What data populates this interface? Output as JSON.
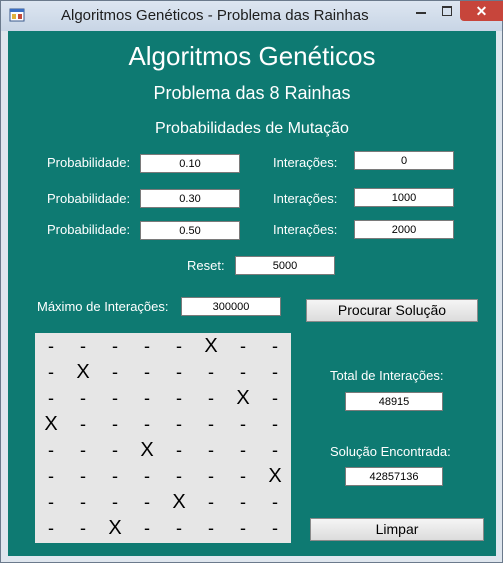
{
  "window": {
    "title": "Algoritmos Genéticos - Problema das Rainhas",
    "close_glyph": "✕"
  },
  "header": {
    "title": "Algoritmos Genéticos",
    "subtitle": "Problema das 8 Rainhas",
    "section": "Probabilidades de Mutação"
  },
  "mutation_rows": [
    {
      "prob_label": "Probabilidade:",
      "prob_value": "0.10",
      "iter_label": "Interações:",
      "iter_value": "0"
    },
    {
      "prob_label": "Probabilidade:",
      "prob_value": "0.30",
      "iter_label": "Interações:",
      "iter_value": "1000"
    },
    {
      "prob_label": "Probabilidade:",
      "prob_value": "0.50",
      "iter_label": "Interações:",
      "iter_value": "2000"
    }
  ],
  "reset": {
    "label": "Reset:",
    "value": "5000"
  },
  "max_iterations": {
    "label": "Máximo de Interações:",
    "value": "300000"
  },
  "search_button": "Procurar Solução",
  "total": {
    "label": "Total de Interações:",
    "value": "48915"
  },
  "solution": {
    "label": "Solução Encontrada:",
    "value": "42857136"
  },
  "clear_button": "Limpar",
  "board": {
    "empty_symbol": "-",
    "queen_symbol": "X",
    "rows": [
      [
        "-",
        "-",
        "-",
        "-",
        "-",
        "X",
        "-",
        "-"
      ],
      [
        "-",
        "X",
        "-",
        "-",
        "-",
        "-",
        "-",
        "-"
      ],
      [
        "-",
        "-",
        "-",
        "-",
        "-",
        "-",
        "X",
        "-"
      ],
      [
        "X",
        "-",
        "-",
        "-",
        "-",
        "-",
        "-",
        "-"
      ],
      [
        "-",
        "-",
        "-",
        "X",
        "-",
        "-",
        "-",
        "-"
      ],
      [
        "-",
        "-",
        "-",
        "-",
        "-",
        "-",
        "-",
        "X"
      ],
      [
        "-",
        "-",
        "-",
        "-",
        "X",
        "-",
        "-",
        "-"
      ],
      [
        "-",
        "-",
        "X",
        "-",
        "-",
        "-",
        "-",
        "-"
      ]
    ]
  },
  "colors": {
    "client_bg": "#0e7a72",
    "board_bg": "#e6e6e6",
    "close_button": "#c7453b"
  }
}
